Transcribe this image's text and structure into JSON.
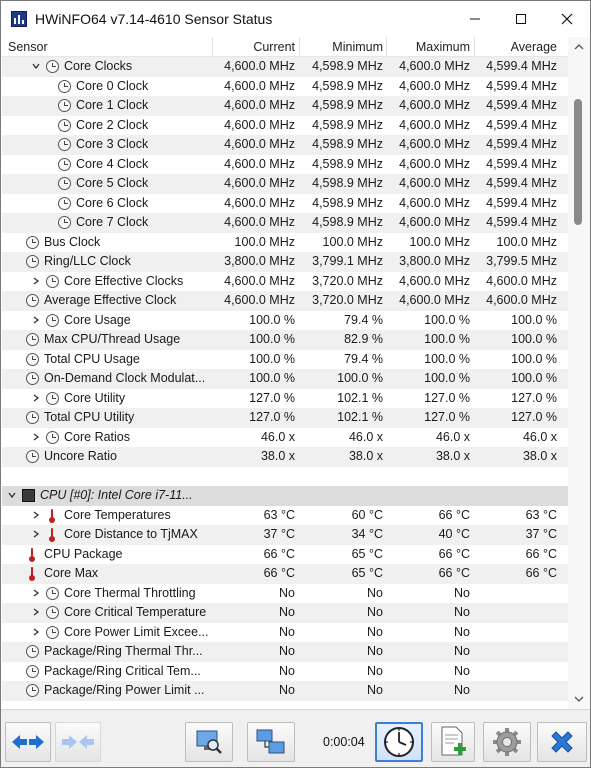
{
  "window": {
    "title": "HWiNFO64 v7.14-4610 Sensor Status"
  },
  "columns": {
    "sensor": "Sensor",
    "current": "Current",
    "minimum": "Minimum",
    "maximum": "Maximum",
    "average": "Average"
  },
  "rows": [
    {
      "indent": 2,
      "expander": "expanded",
      "icon": "clock-icon",
      "label": "Core Clocks",
      "current": "4,600.0 MHz",
      "minimum": "4,598.9 MHz",
      "maximum": "4,600.0 MHz",
      "average": "4,599.4 MHz"
    },
    {
      "indent": 3,
      "expander": "",
      "icon": "clock-icon",
      "label": "Core 0 Clock",
      "current": "4,600.0 MHz",
      "minimum": "4,598.9 MHz",
      "maximum": "4,600.0 MHz",
      "average": "4,599.4 MHz"
    },
    {
      "indent": 3,
      "expander": "",
      "icon": "clock-icon",
      "label": "Core 1 Clock",
      "current": "4,600.0 MHz",
      "minimum": "4,598.9 MHz",
      "maximum": "4,600.0 MHz",
      "average": "4,599.4 MHz"
    },
    {
      "indent": 3,
      "expander": "",
      "icon": "clock-icon",
      "label": "Core 2 Clock",
      "current": "4,600.0 MHz",
      "minimum": "4,598.9 MHz",
      "maximum": "4,600.0 MHz",
      "average": "4,599.4 MHz"
    },
    {
      "indent": 3,
      "expander": "",
      "icon": "clock-icon",
      "label": "Core 3 Clock",
      "current": "4,600.0 MHz",
      "minimum": "4,598.9 MHz",
      "maximum": "4,600.0 MHz",
      "average": "4,599.4 MHz"
    },
    {
      "indent": 3,
      "expander": "",
      "icon": "clock-icon",
      "label": "Core 4 Clock",
      "current": "4,600.0 MHz",
      "minimum": "4,598.9 MHz",
      "maximum": "4,600.0 MHz",
      "average": "4,599.4 MHz"
    },
    {
      "indent": 3,
      "expander": "",
      "icon": "clock-icon",
      "label": "Core 5 Clock",
      "current": "4,600.0 MHz",
      "minimum": "4,598.9 MHz",
      "maximum": "4,600.0 MHz",
      "average": "4,599.4 MHz"
    },
    {
      "indent": 3,
      "expander": "",
      "icon": "clock-icon",
      "label": "Core 6 Clock",
      "current": "4,600.0 MHz",
      "minimum": "4,598.9 MHz",
      "maximum": "4,600.0 MHz",
      "average": "4,599.4 MHz"
    },
    {
      "indent": 3,
      "expander": "",
      "icon": "clock-icon",
      "label": "Core 7 Clock",
      "current": "4,600.0 MHz",
      "minimum": "4,598.9 MHz",
      "maximum": "4,600.0 MHz",
      "average": "4,599.4 MHz"
    },
    {
      "indent": 1,
      "expander": "",
      "icon": "clock-icon",
      "label": "Bus Clock",
      "current": "100.0 MHz",
      "minimum": "100.0 MHz",
      "maximum": "100.0 MHz",
      "average": "100.0 MHz"
    },
    {
      "indent": 1,
      "expander": "",
      "icon": "clock-icon",
      "label": "Ring/LLC Clock",
      "current": "3,800.0 MHz",
      "minimum": "3,799.1 MHz",
      "maximum": "3,800.0 MHz",
      "average": "3,799.5 MHz"
    },
    {
      "indent": 2,
      "expander": "collapsed",
      "icon": "clock-icon",
      "label": "Core Effective Clocks",
      "current": "4,600.0 MHz",
      "minimum": "3,720.0 MHz",
      "maximum": "4,600.0 MHz",
      "average": "4,600.0 MHz"
    },
    {
      "indent": 1,
      "expander": "",
      "icon": "clock-icon",
      "label": "Average Effective Clock",
      "current": "4,600.0 MHz",
      "minimum": "3,720.0 MHz",
      "maximum": "4,600.0 MHz",
      "average": "4,600.0 MHz"
    },
    {
      "indent": 2,
      "expander": "collapsed",
      "icon": "clock-icon",
      "label": "Core Usage",
      "current": "100.0 %",
      "minimum": "79.4 %",
      "maximum": "100.0 %",
      "average": "100.0 %"
    },
    {
      "indent": 1,
      "expander": "",
      "icon": "clock-icon",
      "label": "Max CPU/Thread Usage",
      "current": "100.0 %",
      "minimum": "82.9 %",
      "maximum": "100.0 %",
      "average": "100.0 %"
    },
    {
      "indent": 1,
      "expander": "",
      "icon": "clock-icon",
      "label": "Total CPU Usage",
      "current": "100.0 %",
      "minimum": "79.4 %",
      "maximum": "100.0 %",
      "average": "100.0 %"
    },
    {
      "indent": 1,
      "expander": "",
      "icon": "clock-icon",
      "label": "On-Demand Clock Modulat...",
      "current": "100.0 %",
      "minimum": "100.0 %",
      "maximum": "100.0 %",
      "average": "100.0 %"
    },
    {
      "indent": 2,
      "expander": "collapsed",
      "icon": "clock-icon",
      "label": "Core Utility",
      "current": "127.0 %",
      "minimum": "102.1 %",
      "maximum": "127.0 %",
      "average": "127.0 %"
    },
    {
      "indent": 1,
      "expander": "",
      "icon": "clock-icon",
      "label": "Total CPU Utility",
      "current": "127.0 %",
      "minimum": "102.1 %",
      "maximum": "127.0 %",
      "average": "127.0 %"
    },
    {
      "indent": 2,
      "expander": "collapsed",
      "icon": "clock-icon",
      "label": "Core Ratios",
      "current": "46.0 x",
      "minimum": "46.0 x",
      "maximum": "46.0 x",
      "average": "46.0 x"
    },
    {
      "indent": 1,
      "expander": "",
      "icon": "clock-icon",
      "label": "Uncore Ratio",
      "current": "38.0 x",
      "minimum": "38.0 x",
      "maximum": "38.0 x",
      "average": "38.0 x"
    },
    {
      "indent": 0,
      "expander": "",
      "icon": "",
      "label": "",
      "current": "",
      "minimum": "",
      "maximum": "",
      "average": ""
    },
    {
      "indent": 0,
      "expander": "expanded",
      "icon": "chip-icon",
      "label": "CPU [#0]: Intel Core i7-11...",
      "current": "",
      "minimum": "",
      "maximum": "",
      "average": "",
      "group": true
    },
    {
      "indent": 2,
      "expander": "collapsed",
      "icon": "thermometer-icon",
      "label": "Core Temperatures",
      "current": "63 °C",
      "minimum": "60 °C",
      "maximum": "66 °C",
      "average": "63 °C"
    },
    {
      "indent": 2,
      "expander": "collapsed",
      "icon": "thermometer-icon",
      "label": "Core Distance to TjMAX",
      "current": "37 °C",
      "minimum": "34 °C",
      "maximum": "40 °C",
      "average": "37 °C"
    },
    {
      "indent": 1,
      "expander": "",
      "icon": "thermometer-icon",
      "label": "CPU Package",
      "current": "66 °C",
      "minimum": "65 °C",
      "maximum": "66 °C",
      "average": "66 °C"
    },
    {
      "indent": 1,
      "expander": "",
      "icon": "thermometer-icon",
      "label": "Core Max",
      "current": "66 °C",
      "minimum": "65 °C",
      "maximum": "66 °C",
      "average": "66 °C"
    },
    {
      "indent": 2,
      "expander": "collapsed",
      "icon": "clock-icon",
      "label": "Core Thermal Throttling",
      "current": "No",
      "minimum": "No",
      "maximum": "No",
      "average": ""
    },
    {
      "indent": 2,
      "expander": "collapsed",
      "icon": "clock-icon",
      "label": "Core Critical Temperature",
      "current": "No",
      "minimum": "No",
      "maximum": "No",
      "average": ""
    },
    {
      "indent": 2,
      "expander": "collapsed",
      "icon": "clock-icon",
      "label": "Core Power Limit Excee...",
      "current": "No",
      "minimum": "No",
      "maximum": "No",
      "average": ""
    },
    {
      "indent": 1,
      "expander": "",
      "icon": "clock-icon",
      "label": "Package/Ring Thermal Thr...",
      "current": "No",
      "minimum": "No",
      "maximum": "No",
      "average": ""
    },
    {
      "indent": 1,
      "expander": "",
      "icon": "clock-icon",
      "label": "Package/Ring Critical Tem...",
      "current": "No",
      "minimum": "No",
      "maximum": "No",
      "average": ""
    },
    {
      "indent": 1,
      "expander": "",
      "icon": "clock-icon",
      "label": "Package/Ring Power Limit ...",
      "current": "No",
      "minimum": "No",
      "maximum": "No",
      "average": ""
    }
  ],
  "toolbar": {
    "timer": "0:00:04",
    "buttons": [
      {
        "name": "nav-back-forward-button",
        "icon": "double-arrow-icon"
      },
      {
        "name": "nav-disabled-button",
        "icon": "double-arrow-disabled-icon"
      },
      {
        "name": "monitor-search-button",
        "icon": "monitor-search-icon"
      },
      {
        "name": "network-button",
        "icon": "network-icon"
      },
      {
        "name": "clock-timer-button",
        "icon": "clock-icon"
      },
      {
        "name": "add-log-button",
        "icon": "log-add-icon"
      },
      {
        "name": "settings-button",
        "icon": "gear-icon"
      },
      {
        "name": "close-sensors-button",
        "icon": "close-x-icon"
      }
    ]
  },
  "colors": {
    "row_alt": "#f0f0f0",
    "group_row": "#dcdcdc",
    "accent": "#3c7fd6",
    "thermo_red": "#c02020",
    "arrow_blue": "#1f6fd1"
  }
}
